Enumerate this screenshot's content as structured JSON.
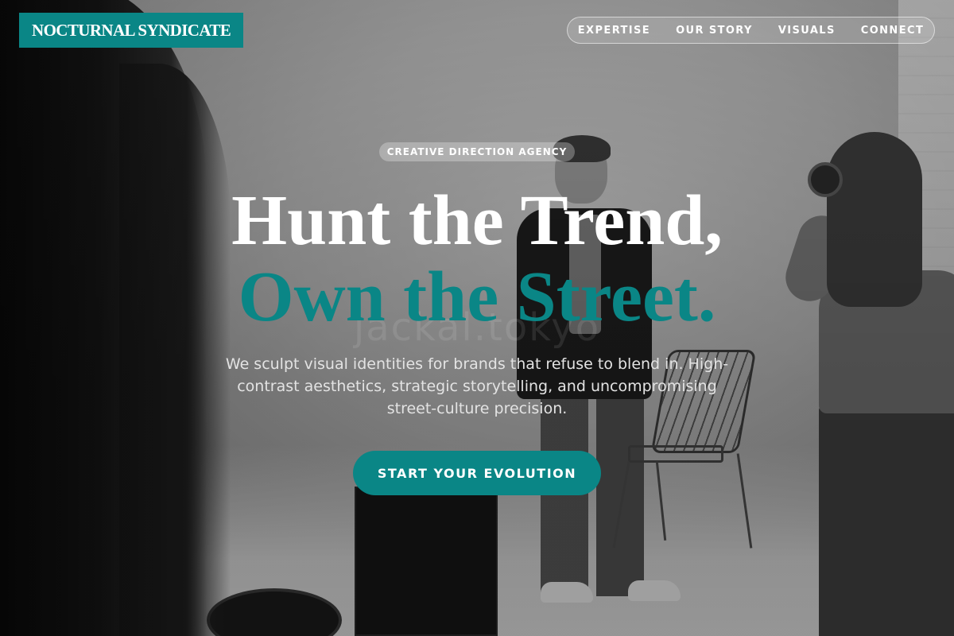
{
  "brand": {
    "name": "NOCTURNAL SYNDICATE",
    "accent_color": "#0a8686"
  },
  "nav": {
    "items": [
      {
        "label": "EXPERTISE"
      },
      {
        "label": "OUR STORY"
      },
      {
        "label": "VISUALS"
      },
      {
        "label": "CONNECT"
      }
    ]
  },
  "hero": {
    "badge": "CREATIVE DIRECTION AGENCY",
    "headline_line1": "Hunt the Trend,",
    "headline_line2": "Own the Street.",
    "watermark": "jackal.tokyo",
    "tagline": "We sculpt visual identities for brands that refuse to blend in. High-contrast aesthetics, strategic storytelling, and uncompromising street-culture precision.",
    "cta_label": "START YOUR EVOLUTION"
  }
}
